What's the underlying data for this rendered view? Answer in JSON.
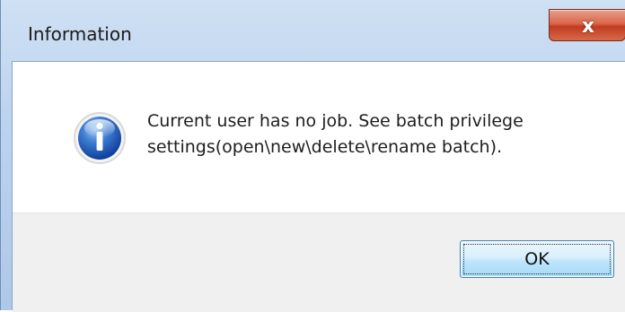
{
  "window": {
    "title": "Information",
    "close_glyph": "x",
    "close_icon": "close-icon"
  },
  "message": {
    "icon": "info-icon",
    "lines": [
      "Current user has no job. See batch privilege",
      "settings(open\\new\\delete\\rename batch)."
    ]
  },
  "buttons": {
    "ok_label": "OK"
  },
  "colors": {
    "titlebar": "#bcd3ee",
    "close_button": "#c23b1f",
    "content_bg": "#ffffff",
    "button_bar_bg": "#f0f0f0",
    "ok_button_border": "#3c7fb1"
  }
}
